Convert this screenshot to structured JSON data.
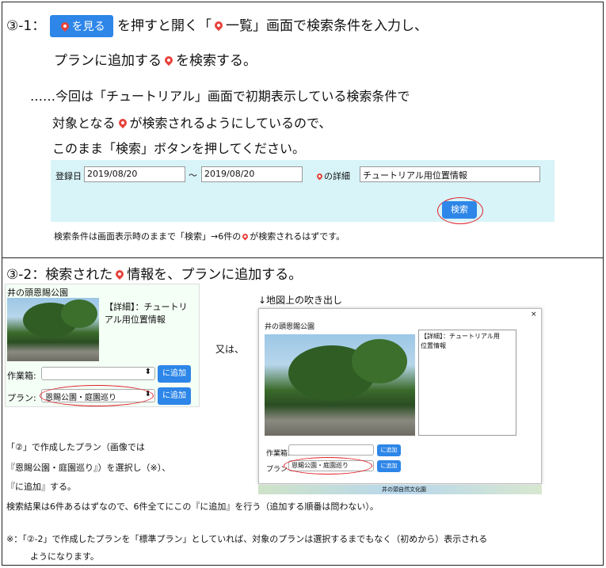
{
  "step1": {
    "number": "③-1：",
    "view_button": "を見る",
    "line1_after_button": "を押すと開く「",
    "line1_list": "一覧」画面で検索条件を入力し、",
    "line2_a": "プランに追加する",
    "line2_b": "を検索する。",
    "note1": "……今回は「チュートリアル」画面で初期表示している検索条件で",
    "note2_a": "対象となる",
    "note2_b": "が検索されるようにしているので、",
    "note3": "このまま「検索」ボタンを押してください。",
    "search": {
      "date_label": "登録日",
      "date_from": "2019/08/20",
      "tilde": "〜",
      "date_to": "2019/08/20",
      "detail_label": "の詳細",
      "detail_value": "チュートリアル用位置情報",
      "search_button": "検索"
    },
    "result_note_a": "検索条件は画面表示時のままで「検索」→6件の",
    "result_note_b": "が検索されるはずです。"
  },
  "step2": {
    "heading_a": "③-2：検索された",
    "heading_b": "情報を、プランに追加する。",
    "panel": {
      "title": "井の頭恩賜公園",
      "detail": "【詳細】：チュートリ\nアル用位置情報",
      "workbox_label": "作業箱:",
      "add_label": "に追加",
      "plan_label": "プラン:",
      "plan_value": "恩賜公園・庭園巡り",
      "add_label2": "に追加"
    },
    "or_text": "又は、",
    "map_caption": "↓地図上の吹き出し",
    "popup": {
      "title": "井の頭恩賜公園",
      "close": "×",
      "detail": "【詳細】：チュートリアル用\n位置情報",
      "workbox_label": "作業箱:",
      "add_label": "に追加",
      "plan_label": "プラン",
      "plan_value": "恩賜公園・庭園巡り",
      "add_label2": "に追加",
      "map_text": "井の頭自然文化園"
    },
    "instr1": "「②」で作成したプラン（画像では",
    "instr2": "『恩賜公園・庭園巡り』）を選択し（※）、",
    "instr3": "『に追加』する。",
    "result_note": "検索結果は6件あるはずなので、6件全てにこの『に追加』を行う（追加する順番は問わない）。",
    "footnote1": "※：「②-2」で作成したプランを「標準プラン」としていれば、対象のプランは選択するまでもなく（初めから）表示される",
    "footnote2": "ようになります。"
  }
}
